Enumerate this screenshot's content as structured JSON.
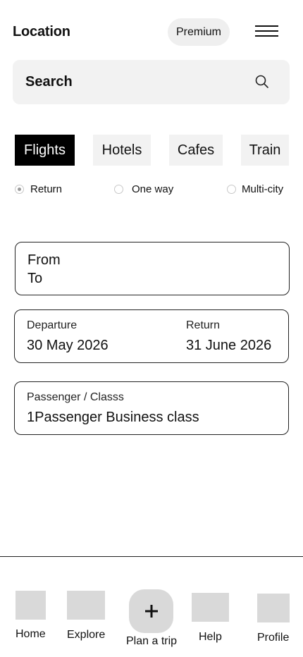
{
  "header": {
    "title": "Location",
    "premium_label": "Premium"
  },
  "search": {
    "label": "Search"
  },
  "tabs": [
    {
      "label": "Flights",
      "active": true
    },
    {
      "label": "Hotels",
      "active": false
    },
    {
      "label": "Cafes",
      "active": false
    },
    {
      "label": "Train",
      "active": false
    }
  ],
  "trip_types": [
    {
      "label": "Return",
      "selected": true
    },
    {
      "label": "One way",
      "selected": false
    },
    {
      "label": "Multi-city",
      "selected": false
    }
  ],
  "route": {
    "from_label": "From",
    "to_label": "To"
  },
  "dates": {
    "departure_label": "Departure",
    "departure_value": "30 May 2026",
    "return_label": "Return",
    "return_value": "31 June 2026"
  },
  "passenger": {
    "label": "Passenger / Classs",
    "value": "1Passenger Business class"
  },
  "bottom_nav": {
    "home": "Home",
    "explore": "Explore",
    "plan": "Plan a trip",
    "help": "Help",
    "profile": "Profile"
  },
  "colors": {
    "accent": "#000000",
    "surface": "#f2f2f2",
    "placeholder_box": "#d9d9d9"
  }
}
